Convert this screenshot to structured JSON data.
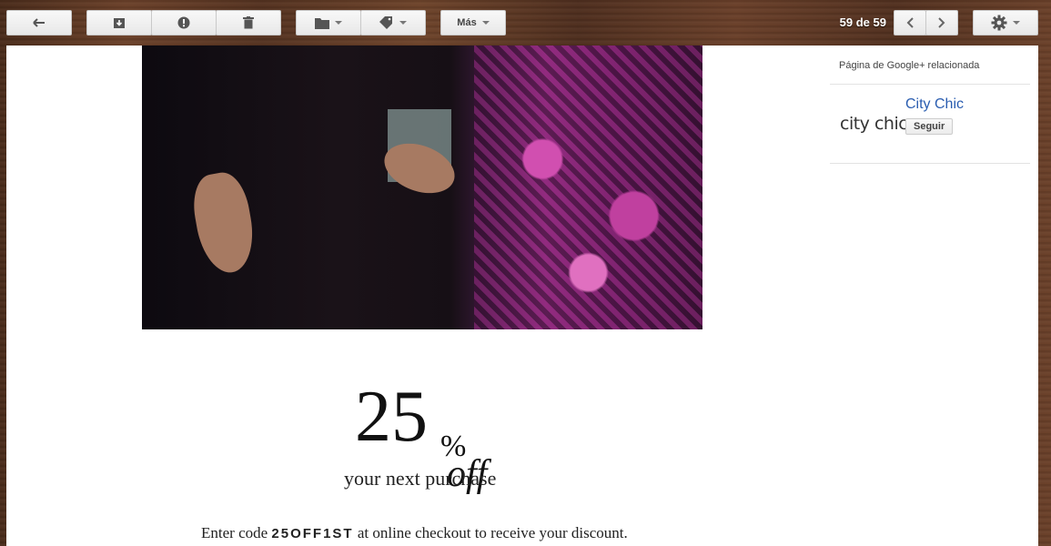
{
  "toolbar": {
    "more_label": "Más",
    "count_label": "59 de 59"
  },
  "icons": [
    "back-arrow-icon",
    "archive-icon",
    "spam-icon",
    "trash-icon",
    "folder-icon",
    "label-icon",
    "chevron-left-icon",
    "chevron-right-icon",
    "gear-icon"
  ],
  "sidebar": {
    "related_title": "Página de Google+ relacionada",
    "brand_logo_text": "city chic",
    "brand_name": "City Chic",
    "follow_label": "Seguir"
  },
  "promo": {
    "amount": "25",
    "percent": "%",
    "off": "off",
    "subtitle": "your next purchase",
    "code_prefix": "Enter code",
    "code": "25OFF1ST",
    "code_suffix": "at online checkout to receive your discount."
  }
}
